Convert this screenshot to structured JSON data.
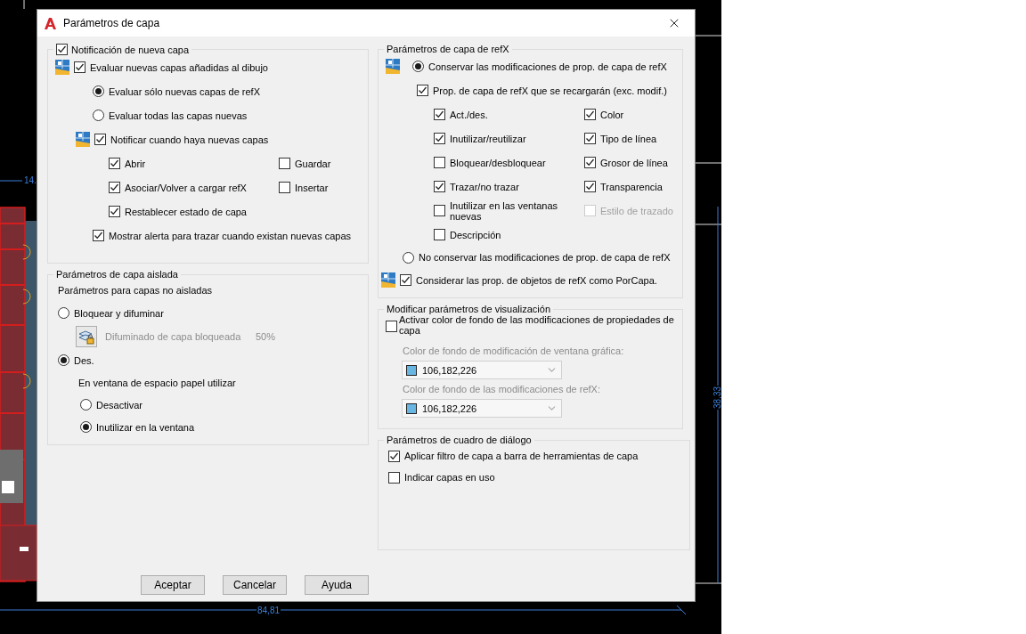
{
  "cad": {
    "labels": [
      "14.",
      "84,81",
      "38,33"
    ]
  },
  "window": {
    "title": "Parámetros de capa"
  },
  "new_layer_notification": {
    "label": "Notificación de nueva capa",
    "checked": true,
    "evaluate": {
      "label": "Evaluar nuevas capas añadidas al dibujo",
      "checked": true
    },
    "evaluate_options": [
      {
        "label": "Evaluar sólo nuevas capas de refX",
        "selected": true
      },
      {
        "label": "Evaluar todas las capas nuevas",
        "selected": false
      }
    ],
    "notify": {
      "label": "Notificar cuando haya nuevas capas",
      "checked": true
    },
    "notify_options": [
      {
        "label": "Abrir",
        "checked": true
      },
      {
        "label": "Guardar",
        "checked": false
      },
      {
        "label": "Asociar/Volver a cargar refX",
        "checked": true
      },
      {
        "label": "Insertar",
        "checked": false
      },
      {
        "label": "Restablecer estado de capa",
        "checked": true
      }
    ],
    "alert": {
      "label": "Mostrar alerta para trazar cuando existan nuevas capas",
      "checked": true
    }
  },
  "isolated_layers": {
    "title": "Parámetros de capa aislada",
    "subtitle": "Parámetros para capas no aisladas",
    "lock_fade": {
      "label": "Bloquear y difuminar",
      "selected": false
    },
    "fade": {
      "label": "Difuminado de capa bloqueada",
      "value": "50%",
      "disabled": true
    },
    "off": {
      "label": "Des.",
      "selected": true
    },
    "viewport_label": "En ventana de espacio papel utilizar",
    "viewport_options": [
      {
        "label": "Desactivar",
        "selected": false
      },
      {
        "label": "Inutilizar en la ventana",
        "selected": true
      }
    ]
  },
  "xref": {
    "title": "Parámetros de capa de refX",
    "retain": {
      "label": "Conservar las modificaciones de prop. de capa de refX",
      "selected": true
    },
    "reload": {
      "label": "Prop. de capa de refX que se recargarán (exc. modif.)",
      "checked": true
    },
    "properties": [
      {
        "label": "Act./des.",
        "checked": true,
        "disabled": false
      },
      {
        "label": "Color",
        "checked": true,
        "disabled": false
      },
      {
        "label": "Inutilizar/reutilizar",
        "checked": true,
        "disabled": false
      },
      {
        "label": "Tipo de línea",
        "checked": true,
        "disabled": false
      },
      {
        "label": "Bloquear/desbloquear",
        "checked": false,
        "disabled": false
      },
      {
        "label": "Grosor de línea",
        "checked": true,
        "disabled": false
      },
      {
        "label": "Trazar/no trazar",
        "checked": true,
        "disabled": false
      },
      {
        "label": "Transparencia",
        "checked": true,
        "disabled": false
      },
      {
        "label": "Inutilizar en las ventanas nuevas",
        "checked": false,
        "disabled": false
      },
      {
        "label": "Estilo de trazado",
        "checked": false,
        "disabled": true
      },
      {
        "label": "Descripción",
        "checked": false,
        "disabled": false
      }
    ],
    "no_retain": {
      "label": "No conservar las modificaciones de prop. de capa de refX",
      "selected": false
    },
    "by_layer": {
      "label": "Considerar las prop. de objetos de refX como PorCapa.",
      "checked": true
    }
  },
  "display": {
    "title": "Modificar parámetros de visualización",
    "enable": {
      "label": "Activar color de fondo de las modificaciones de propiedades de capa",
      "checked": false
    },
    "colors": [
      {
        "label": "Color de fondo de modificación de ventana gráfica:",
        "value": "106,182,226",
        "color": "#6ab6e2",
        "disabled": true
      },
      {
        "label": "Color de fondo de las modificaciones de refX:",
        "value": "106,182,226",
        "color": "#6ab6e2",
        "disabled": true
      }
    ]
  },
  "dialog_settings": {
    "title": "Parámetros de cuadro de diálogo",
    "options": [
      {
        "label": "Aplicar filtro de capa a barra de herramientas de capa",
        "checked": true
      },
      {
        "label": "Indicar capas en uso",
        "checked": false
      }
    ]
  },
  "buttons": [
    "Aceptar",
    "Cancelar",
    "Ayuda"
  ]
}
